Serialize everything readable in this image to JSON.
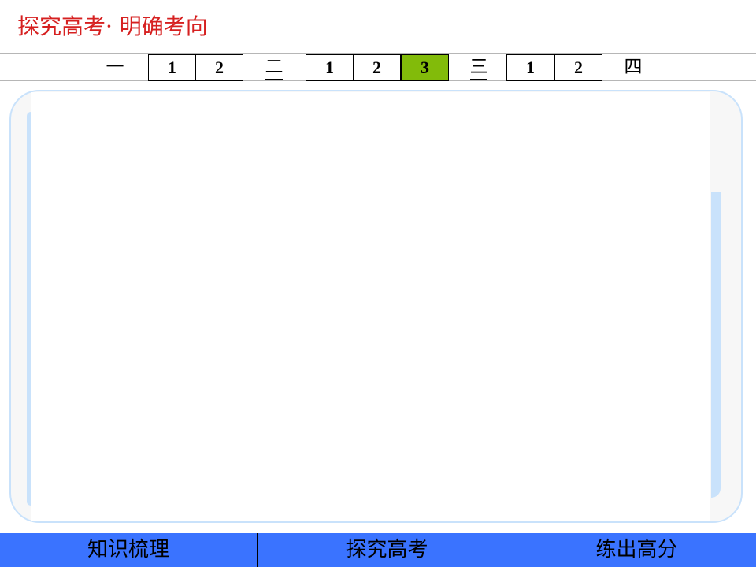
{
  "header": {
    "title": "探究高考· 明确考向",
    "title_color": "#d62020"
  },
  "nav": {
    "section_1": "一",
    "section_1_items": [
      "1",
      "2"
    ],
    "section_2": "二",
    "section_2_items": [
      "1",
      "2",
      "3"
    ],
    "section_2_active_index": 2,
    "section_3": "三",
    "section_3_items": [
      "1",
      "2"
    ],
    "section_4": "四",
    "active_color": "#82bb0a"
  },
  "bottom_nav": {
    "items": [
      "知识梳理",
      "探究高考",
      "练出高分"
    ],
    "background": "#3a73ff"
  }
}
